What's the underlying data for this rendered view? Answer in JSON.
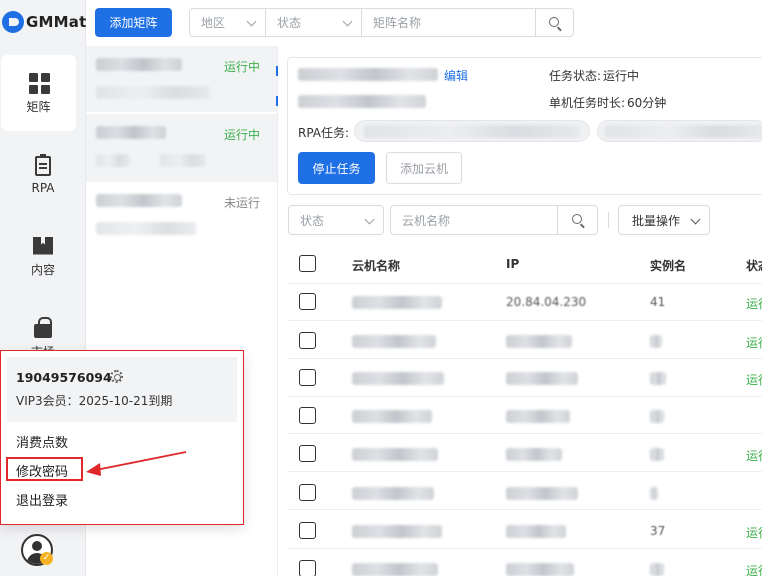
{
  "app": {
    "logo_text": "GMMat"
  },
  "nav": {
    "items": [
      {
        "label": "矩阵",
        "icon": "grid-icon"
      },
      {
        "label": "RPA",
        "icon": "clipboard-icon"
      },
      {
        "label": "内容",
        "icon": "book-icon"
      },
      {
        "label": "市场",
        "icon": "bag-icon"
      }
    ]
  },
  "toolbar": {
    "add_matrix_label": "添加矩阵",
    "region_placeholder": "地区",
    "status_placeholder": "状态",
    "matrix_name_placeholder": "矩阵名称"
  },
  "matrix_list": [
    {
      "status": "运行中",
      "status_type": "running"
    },
    {
      "status": "运行中",
      "status_type": "running"
    },
    {
      "status": "未运行",
      "status_type": "stopped"
    }
  ],
  "detail": {
    "edit_label": "编辑",
    "task_status_label": "任务状态:",
    "task_status_value": "运行中",
    "duration_label": "单机任务时长:",
    "duration_value": "60分钟",
    "rpa_task_label": "RPA任务:",
    "stop_task_label": "停止任务",
    "add_cloud_label": "添加云机"
  },
  "cloud_filter": {
    "status_placeholder": "状态",
    "name_placeholder": "云机名称",
    "batch_label": "批量操作"
  },
  "table": {
    "columns": [
      "云机名称",
      "IP",
      "实例名",
      "状态"
    ],
    "rows": [
      {
        "ip": "20.84.04.230",
        "instance": "41",
        "status": "运行"
      },
      {
        "ip": "",
        "instance": "",
        "status": "运行"
      },
      {
        "ip": "",
        "instance": "",
        "status": "运行"
      },
      {
        "ip": "",
        "instance": "",
        "status": ""
      },
      {
        "ip": "",
        "instance": "",
        "status": "运行"
      },
      {
        "ip": "",
        "instance": "",
        "status": ""
      },
      {
        "ip": "",
        "instance": "37",
        "status": "运行"
      },
      {
        "ip": "",
        "instance": "",
        "status": "运行"
      }
    ]
  },
  "user_menu": {
    "phone": "19049576094",
    "vip": "VIP3会员：2025-10-21到期",
    "items": [
      "消费点数",
      "修改密码",
      "退出登录"
    ]
  },
  "colors": {
    "primary": "#1f6fe5",
    "running": "#3bb04a",
    "annotation": "#e0282b"
  }
}
